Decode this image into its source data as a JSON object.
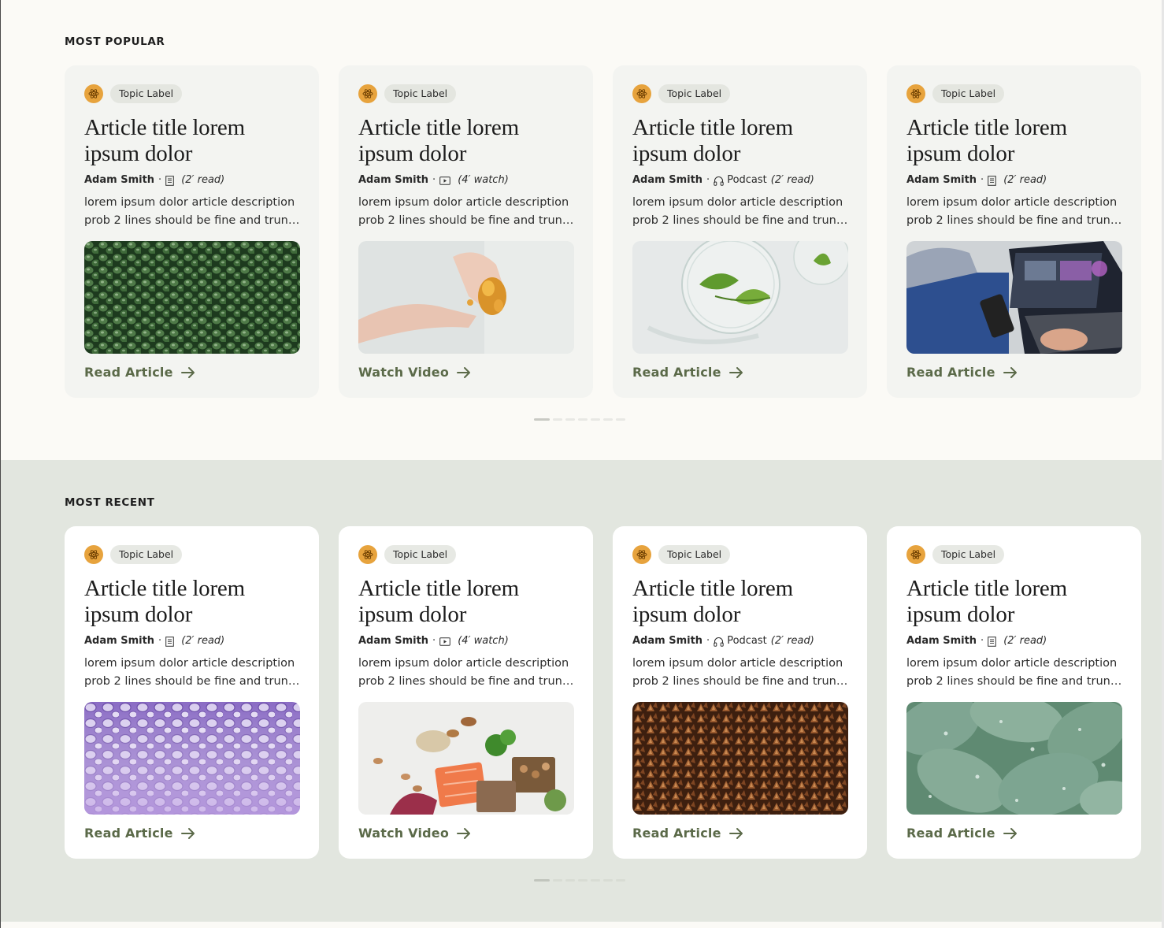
{
  "colors": {
    "popular_bg": "#fbfaf6",
    "recent_bg": "#e2e6df",
    "accent_icon": "#e7a33d",
    "cta_green": "#5b6a49"
  },
  "sections": [
    {
      "title": "MOST POPULAR",
      "cards": [
        {
          "topic": "Topic Label",
          "topic_icon": "atom-icon",
          "title": "Article title lorem ipsum dolor",
          "author": "Adam Smith",
          "sep": "·",
          "media_icon": "document-icon",
          "media_label": "",
          "duration": "(2′ read)",
          "desc_line1": "lorem ipsum dolor article description",
          "desc_line2": "prob 2 lines should be fine and truncate",
          "image": "green-seeds-image",
          "cta": "Read Article"
        },
        {
          "topic": "Topic Label",
          "topic_icon": "atom-icon",
          "title": "Article title lorem ipsum dolor",
          "author": "Adam Smith",
          "sep": "·",
          "media_icon": "video-icon",
          "media_label": "",
          "duration": "(4′ watch)",
          "desc_line1": "lorem ipsum dolor article description",
          "desc_line2": "prob 2 lines should be fine and truncate",
          "image": "hands-capsules-image",
          "cta": "Watch Video"
        },
        {
          "topic": "Topic Label",
          "topic_icon": "atom-icon",
          "title": "Article title lorem ipsum dolor",
          "author": "Adam Smith",
          "sep": "·",
          "media_icon": "headphones-icon",
          "media_label": "Podcast",
          "duration": "(2′ read)",
          "desc_line1": "lorem ipsum dolor article description",
          "desc_line2": "prob 2 lines should be fine and truncate",
          "image": "petri-dish-leaf-image",
          "cta": "Read Article"
        },
        {
          "topic": "Topic Label",
          "topic_icon": "atom-icon",
          "title": "Article title lorem ipsum dolor",
          "author": "Adam Smith",
          "sep": "·",
          "media_icon": "document-icon",
          "media_label": "",
          "duration": "(2′ read)",
          "desc_line1": "lorem ipsum dolor article description",
          "desc_line2": "prob 2 lines should be fine and truncate",
          "image": "doctor-laptop-image",
          "cta": "Read Article"
        }
      ]
    },
    {
      "title": "MOST RECENT",
      "cards": [
        {
          "topic": "Topic Label",
          "topic_icon": "atom-icon",
          "title": "Article title lorem ipsum dolor",
          "author": "Adam Smith",
          "sep": "·",
          "media_icon": "document-icon",
          "media_label": "",
          "duration": "(2′ read)",
          "desc_line1": "lorem ipsum dolor article description",
          "desc_line2": "prob 2 lines should be fine and truncate",
          "image": "purple-cells-image",
          "cta": "Read Article"
        },
        {
          "topic": "Topic Label",
          "topic_icon": "atom-icon",
          "title": "Article title lorem ipsum dolor",
          "author": "Adam Smith",
          "sep": "·",
          "media_icon": "video-icon",
          "media_label": "",
          "duration": "(4′ watch)",
          "desc_line1": "lorem ipsum dolor article description",
          "desc_line2": "prob 2 lines should be fine and truncate",
          "image": "healthy-food-image",
          "cta": "Watch Video"
        },
        {
          "topic": "Topic Label",
          "topic_icon": "atom-icon",
          "title": "Article title lorem ipsum dolor",
          "author": "Adam Smith",
          "sep": "·",
          "media_icon": "headphones-icon",
          "media_label": "Podcast",
          "duration": "(2′ read)",
          "desc_line1": "lorem ipsum dolor article description",
          "desc_line2": "prob 2 lines should be fine and truncate",
          "image": "buckwheat-image",
          "cta": "Read Article"
        },
        {
          "topic": "Topic Label",
          "topic_icon": "atom-icon",
          "title": "Article title lorem ipsum dolor",
          "author": "Adam Smith",
          "sep": "·",
          "media_icon": "document-icon",
          "media_label": "",
          "duration": "(2′ read)",
          "desc_line1": "lorem ipsum dolor article description",
          "desc_line2": "prob 2 lines should be fine and truncate",
          "image": "eucalyptus-leaves-image",
          "cta": "Read Article"
        }
      ]
    }
  ]
}
